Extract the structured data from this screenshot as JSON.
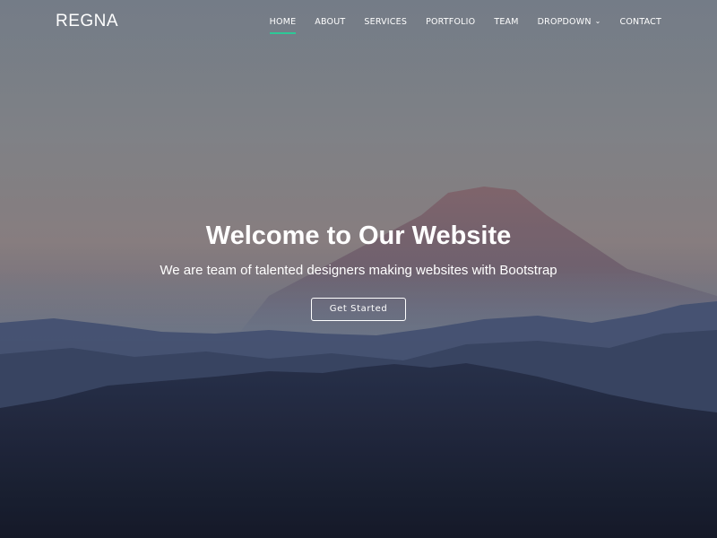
{
  "header": {
    "logo": "REGNA",
    "nav": [
      {
        "label": "HOME",
        "active": true
      },
      {
        "label": "ABOUT"
      },
      {
        "label": "SERVICES"
      },
      {
        "label": "PORTFOLIO"
      },
      {
        "label": "TEAM"
      },
      {
        "label": "DROPDOWN",
        "has_dropdown": true
      },
      {
        "label": "CONTACT"
      }
    ],
    "chevron_icon": "chevron-down-icon",
    "accent_color": "#2dc997"
  },
  "hero": {
    "title": "Welcome to Our Website",
    "subtitle": "We are team of talented designers making websites with Bootstrap",
    "button_label": "Get Started"
  }
}
